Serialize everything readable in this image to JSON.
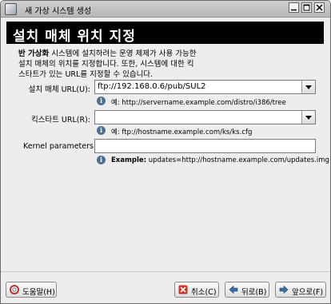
{
  "window": {
    "title": "새 가상 시스템 생성"
  },
  "header": {
    "title": "설치 매체 위치 지정"
  },
  "intro": {
    "bold": "반 가상화",
    "line1": " 시스템에 설치하려는 운영 체제가 사용 가능한",
    "line2": "설치 매체의 위치를 지정합니다. 또한, 시스템에 대한 킥",
    "line3": "스타트가 있는 URL를 지정할 수 있습니다."
  },
  "fields": {
    "install_url": {
      "label": "설치 매체 URL(U):",
      "value": "ftp://192.168.0.6/pub/SUL2",
      "hint_prefix": "예:",
      "hint": "http://servername.example.com/distro/i386/tree"
    },
    "kickstart_url": {
      "label": "킥스타트 URL(R):",
      "value": "",
      "hint_prefix": "예:",
      "hint": "ftp://hostname.example.com/ks/ks.cfg"
    },
    "kernel_params": {
      "label": "Kernel parameters:",
      "value": "",
      "hint_prefix": "Example:",
      "hint": "updates=http://hostname.example.com/updates.img"
    }
  },
  "buttons": {
    "help": "도움말(H)",
    "cancel": "취소(C)",
    "back": "뒤로(B)",
    "forward": "앞으로(F)"
  },
  "colors": {
    "header_bg": "#000000",
    "header_text": "#ffffff",
    "info_icon": "#4d6d93",
    "dialog_bg": "#ededed"
  },
  "icons": [
    "window-app-icon",
    "minimize-icon",
    "maximize-icon",
    "close-icon",
    "info-icon",
    "help-lifebuoy-icon",
    "cancel-x-icon",
    "back-arrow-icon",
    "forward-arrow-icon"
  ]
}
